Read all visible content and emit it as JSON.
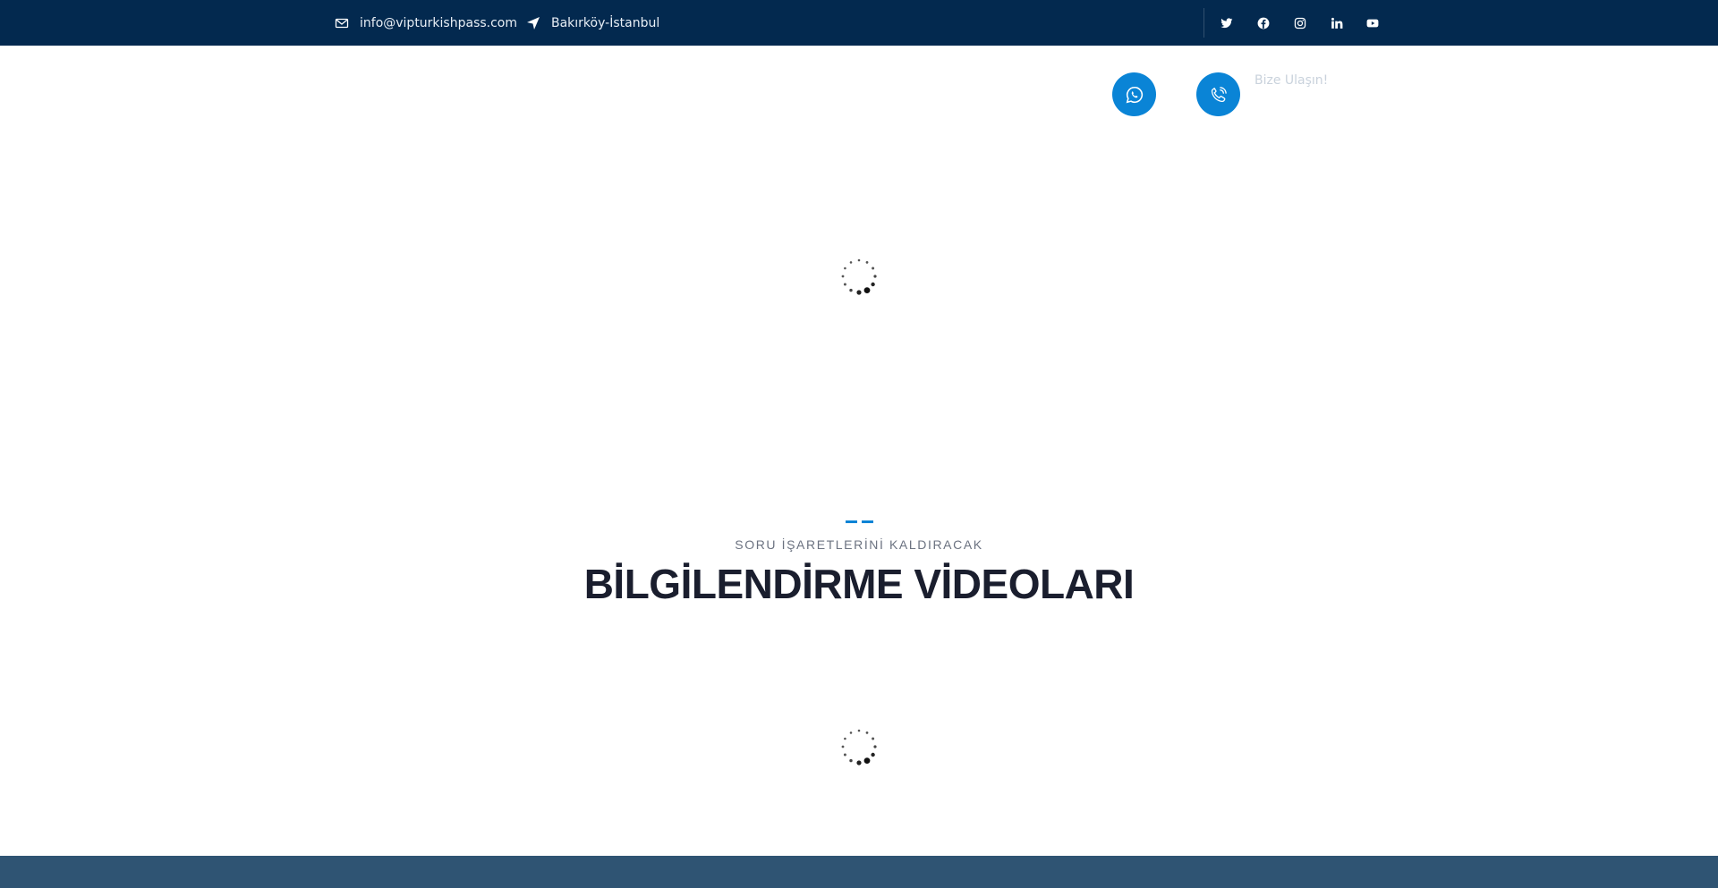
{
  "topbar": {
    "email": "info@vipturkishpass.com",
    "location": "Bakırköy-İstanbul",
    "social_icons": [
      "twitter-icon",
      "facebook-icon",
      "instagram-icon",
      "linkedin-icon",
      "youtube-icon"
    ]
  },
  "header": {
    "contact_label": "Bize Ulaşın!"
  },
  "section": {
    "subtitle": "SORU İŞARETLERİNİ KALDIRACAK",
    "title": "BİLGİLENDİRME VİDEOLARI"
  },
  "colors": {
    "topbar_bg": "#03294f",
    "accent": "#0a84d6",
    "title": "#1a1e2e",
    "footer_bg": "#2f5473"
  }
}
